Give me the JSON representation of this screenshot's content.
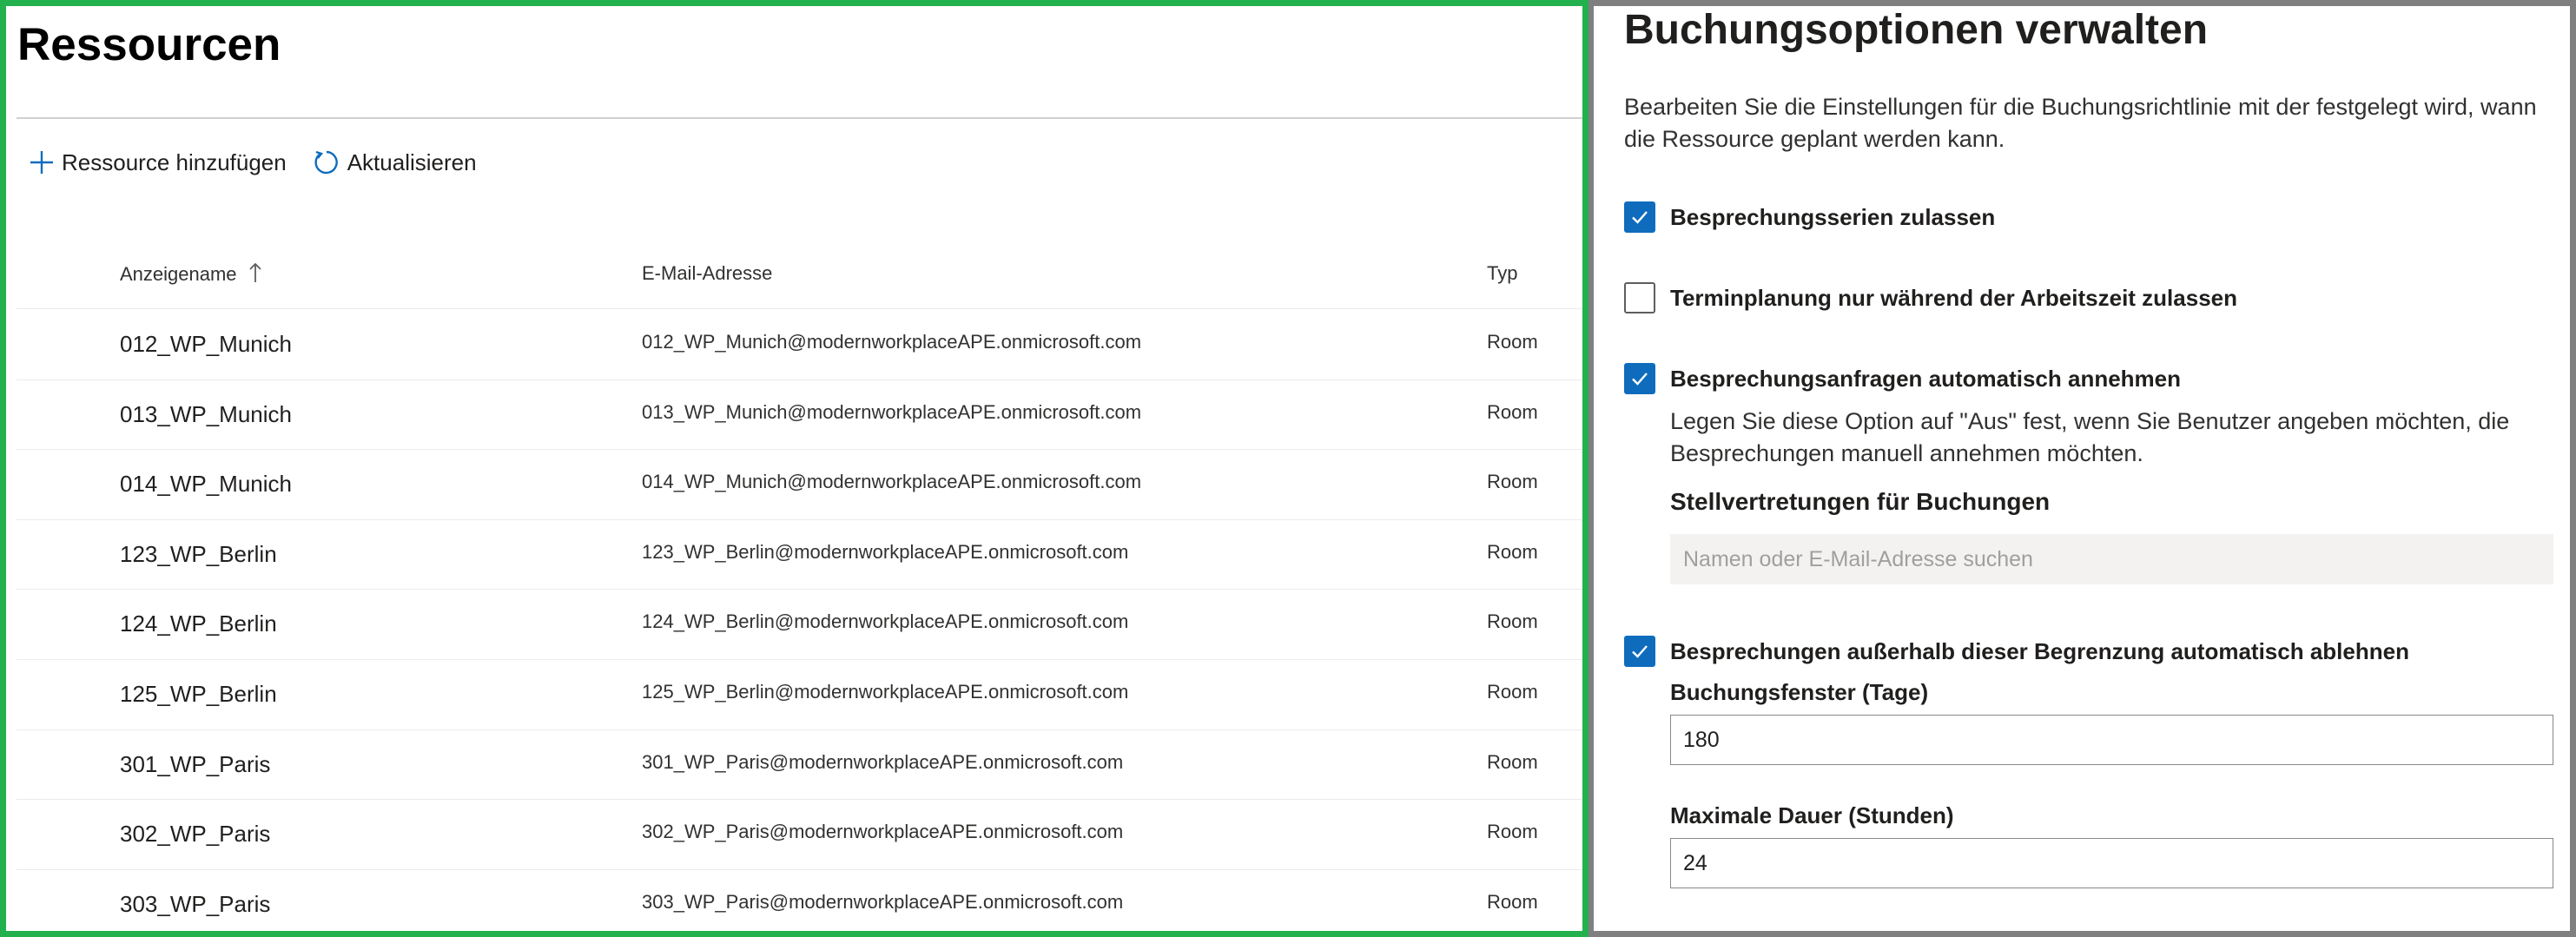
{
  "resources": {
    "title": "Ressourcen",
    "commands": {
      "add_label": "Ressource hinzufügen",
      "refresh_label": "Aktualisieren"
    },
    "columns": {
      "name": "Anzeigename",
      "email": "E-Mail-Adresse",
      "type": "Typ"
    },
    "sort_icon": "arrow-up-icon",
    "rows": [
      {
        "name": "012_WP_Munich",
        "email": "012_WP_Munich@modernworkplaceAPE.onmicrosoft.com",
        "type": "Room"
      },
      {
        "name": "013_WP_Munich",
        "email": "013_WP_Munich@modernworkplaceAPE.onmicrosoft.com",
        "type": "Room"
      },
      {
        "name": "014_WP_Munich",
        "email": "014_WP_Munich@modernworkplaceAPE.onmicrosoft.com",
        "type": "Room"
      },
      {
        "name": "123_WP_Berlin",
        "email": "123_WP_Berlin@modernworkplaceAPE.onmicrosoft.com",
        "type": "Room"
      },
      {
        "name": "124_WP_Berlin",
        "email": "124_WP_Berlin@modernworkplaceAPE.onmicrosoft.com",
        "type": "Room"
      },
      {
        "name": "125_WP_Berlin",
        "email": "125_WP_Berlin@modernworkplaceAPE.onmicrosoft.com",
        "type": "Room"
      },
      {
        "name": "301_WP_Paris",
        "email": "301_WP_Paris@modernworkplaceAPE.onmicrosoft.com",
        "type": "Room"
      },
      {
        "name": "302_WP_Paris",
        "email": "302_WP_Paris@modernworkplaceAPE.onmicrosoft.com",
        "type": "Room"
      },
      {
        "name": "303_WP_Paris",
        "email": "303_WP_Paris@modernworkplaceAPE.onmicrosoft.com",
        "type": "Room"
      }
    ]
  },
  "booking": {
    "title": "Buchungsoptionen verwalten",
    "description": "Bearbeiten Sie die Einstellungen für die Buchungsrichtlinie mit der festgelegt wird, wann die Ressource geplant werden kann.",
    "options": {
      "recurring": {
        "label": "Besprechungsserien zulassen",
        "checked": true
      },
      "work_hours": {
        "label": "Terminplanung nur während der Arbeitszeit zulassen",
        "checked": false
      },
      "auto_accept": {
        "label": "Besprechungsanfragen automatisch annehmen",
        "checked": true
      },
      "auto_decline": {
        "label": "Besprechungen außerhalb dieser Begrenzung automatisch ablehnen",
        "checked": true
      }
    },
    "auto_accept_hint": "Legen Sie diese Option auf \"Aus\" fest, wenn Sie Benutzer angeben möchten, die Besprechungen manuell annehmen möchten.",
    "delegates_label": "Stellvertretungen für Buchungen",
    "delegates_placeholder": "Namen oder E-Mail-Adresse suchen",
    "window_label": "Buchungsfenster (Tage)",
    "window_value": "180",
    "duration_label": "Maximale Dauer (Stunden)",
    "duration_value": "24"
  },
  "colors": {
    "accent": "#0f6cbd",
    "left_frame": "#22b14c",
    "right_frame": "#7f7f7f"
  }
}
